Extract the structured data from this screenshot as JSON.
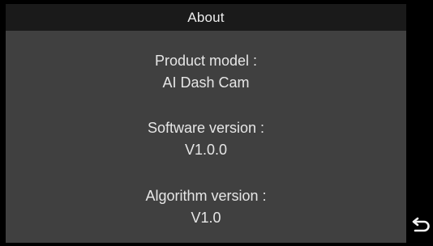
{
  "header": {
    "title": "About"
  },
  "info": {
    "product_model_label": "Product model :",
    "product_model_value": "AI Dash Cam",
    "software_version_label": "Software version :",
    "software_version_value": "V1.0.0",
    "algorithm_version_label": "Algorithm version :",
    "algorithm_version_value": "V1.0"
  },
  "controls": {
    "back_icon": "return-arrow-icon"
  },
  "colors": {
    "background": "#000000",
    "header_bg": "#1a1a1a",
    "content_bg": "#404040",
    "text": "#e6e6e6"
  }
}
